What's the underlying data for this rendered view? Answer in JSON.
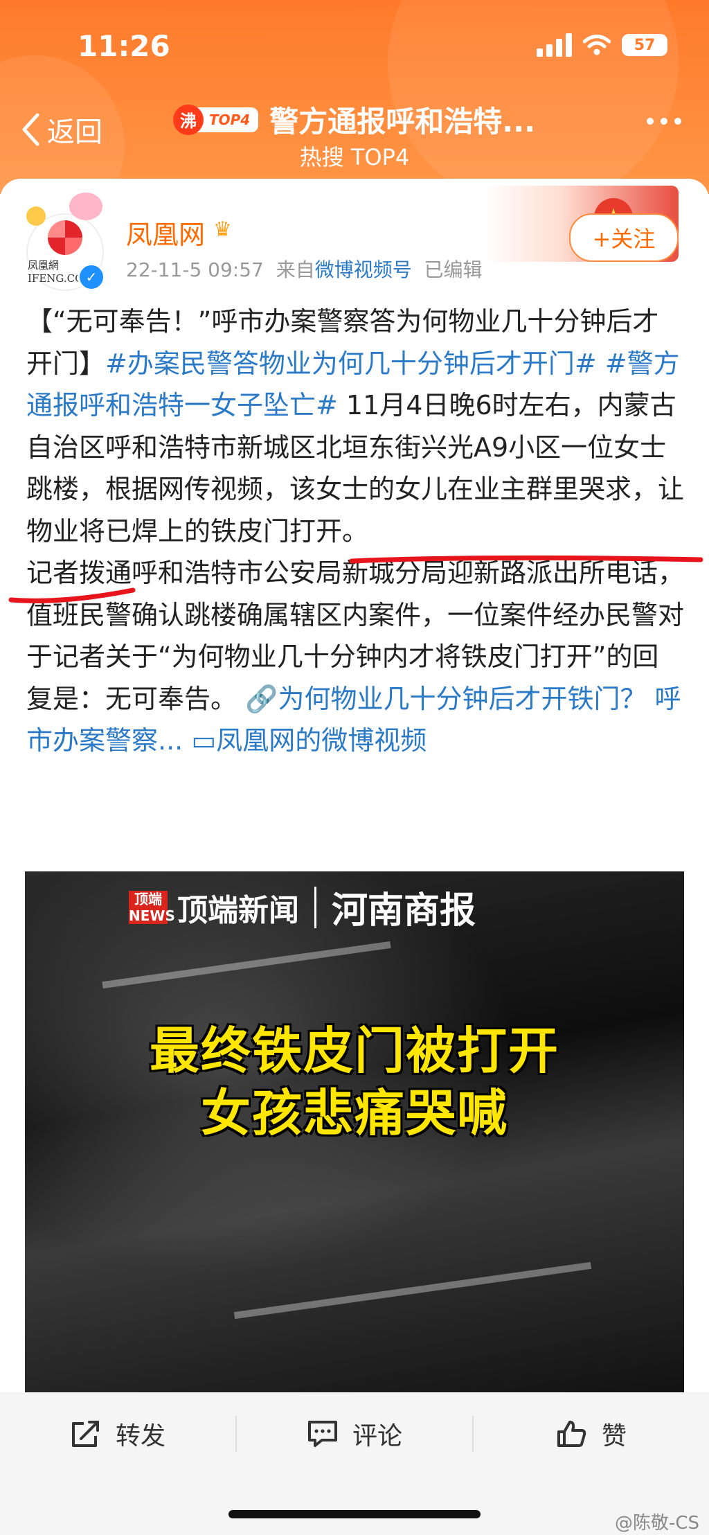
{
  "status_bar": {
    "time": "11:26",
    "battery": "57"
  },
  "nav": {
    "back_label": "返回",
    "hot_badge_char": "沸",
    "hot_badge_rank": "TOP4",
    "title": "警方通报呼和浩特...",
    "subtitle": "热搜 TOP4"
  },
  "post": {
    "author": "凤凰网",
    "avatar_caption": "凤凰網 IFENG.COM",
    "date": "22-11-5 09:57",
    "source_prefix": "来自",
    "source": "微博视频号",
    "edited": "已编辑",
    "follow_label": "+关注",
    "text_intro": "【“无可奉告！”呼市办案警察答为何物业几十分钟后才开门】",
    "tag1": "#办案民警答物业为何几十分钟后才开门#",
    "tag2": "#警方通报呼和浩特一女子坠亡#",
    "text_body1": " 11月4日晚6时左右，内蒙古自治区呼和浩特市新城区北垣东街兴光A9小区一位女士跳楼，根据网传视频，该女士的女儿在业主群里哭求，让物业将已焊上的铁皮门打开。",
    "text_body2": "记者拨通呼和浩特市公安局新城分局迎新路派出所电话，值班民警确认跳楼确属辖区内案件，一位案件经办民警对于记者关于“为何物业几十分钟内才将铁皮门打开”的回复是：无可奉告。",
    "link_label": "为何物业几十分钟后才开铁门？ 呼市办案警察...",
    "video_link_label": "凤凰网的微博视频"
  },
  "video": {
    "logo_badge": "顶端 NEWS",
    "logo1": "顶端新闻",
    "logo2": "河南商报",
    "caption_line1": "最终铁皮门被打开",
    "caption_line2": "女孩悲痛哭喊"
  },
  "toolbar": {
    "repost_label": "转发",
    "comment_label": "评论",
    "like_label": "赞"
  },
  "watermark": "@陈敬-CS",
  "colors": {
    "header_orange": "#ff7a2a",
    "link_blue": "#2a7ac8",
    "username_orange": "#ff6a00",
    "caption_yellow": "#ffe600",
    "underline_red": "#e8141c"
  }
}
